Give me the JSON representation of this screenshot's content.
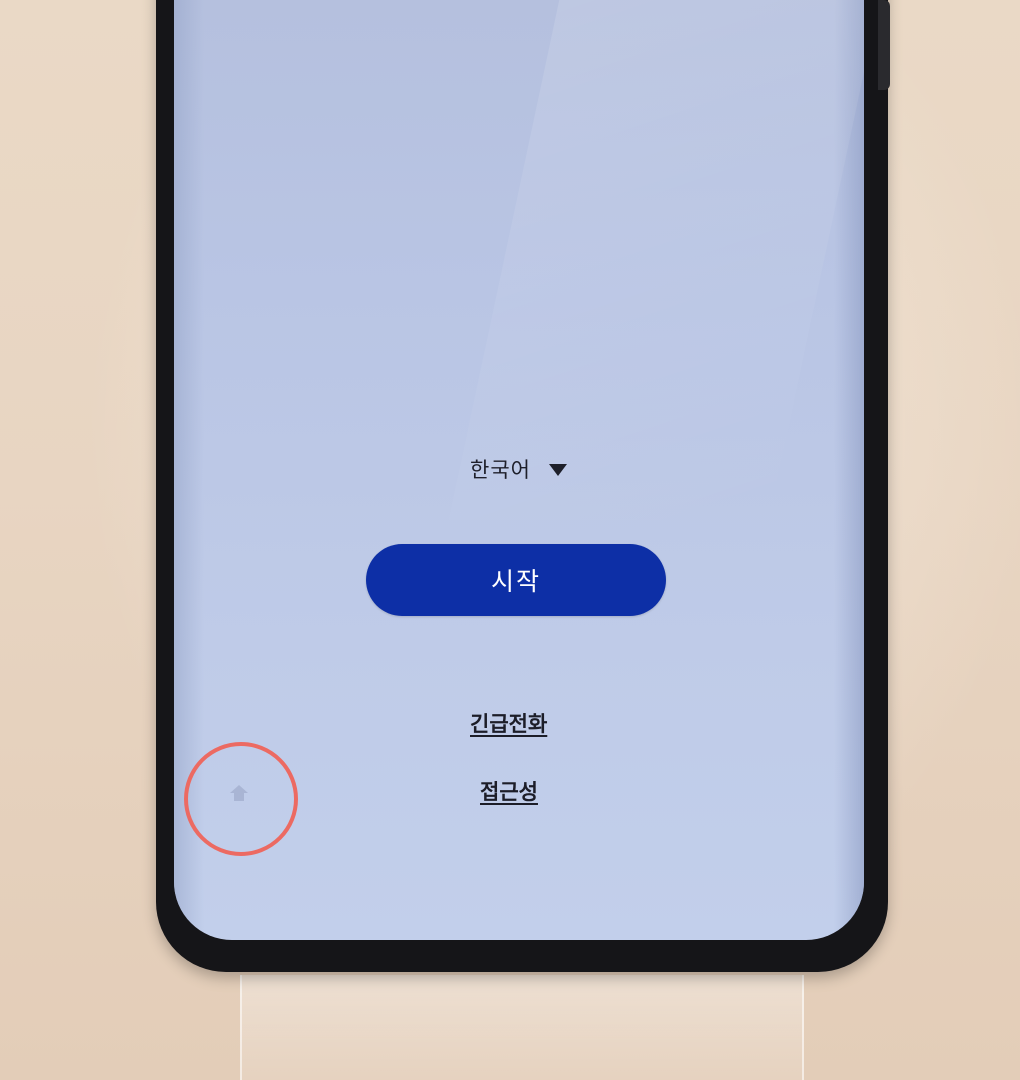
{
  "screen": {
    "language_selector": {
      "label": "한국어",
      "icon": "dropdown-triangle-icon"
    },
    "start_button": {
      "label": "시작",
      "color": "#0d2fa6"
    },
    "links": {
      "emergency_call": "긴급전화",
      "accessibility": "접근성"
    },
    "background_color": "#b9c5e4"
  },
  "overlay": {
    "highlight_circle_color": "#ec6a62"
  }
}
